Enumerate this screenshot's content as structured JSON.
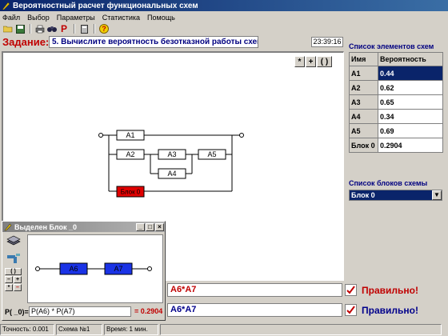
{
  "window": {
    "title": "Вероятностный расчет функциональных схем"
  },
  "menu": [
    "Файл",
    "Выбор",
    "Параметры",
    "Статистика",
    "Помощь"
  ],
  "task": {
    "label": "Задание:",
    "text": "5. Вычислите вероятность безотказной работы схемы",
    "time": "23:39:16"
  },
  "operators": [
    "*",
    "+",
    "( )"
  ],
  "diagram": {
    "blocks": [
      "A1",
      "A2",
      "A3",
      "A4",
      "A5",
      "Блок 0"
    ]
  },
  "elements_list": {
    "title": "Список элементов схем",
    "headers": [
      "Имя",
      "Вероятность"
    ],
    "rows": [
      {
        "name": "A1",
        "value": "0.44"
      },
      {
        "name": "A2",
        "value": "0.62"
      },
      {
        "name": "A3",
        "value": "0.65"
      },
      {
        "name": "A4",
        "value": "0.34"
      },
      {
        "name": "A5",
        "value": "0.69"
      },
      {
        "name": "Блок 0",
        "value": "0.2904"
      }
    ]
  },
  "blocks_list": {
    "title": "Список блоков схемы",
    "selected": "Блок 0"
  },
  "subwindow": {
    "title": "Выделен Блок _0",
    "blocks": [
      "A6",
      "A7"
    ],
    "mini_ops": [
      "( )",
      "–",
      "+",
      "*",
      "–"
    ],
    "formula_label": "P( _0)=",
    "formula": "P(A6) * P(A7)",
    "result": "= 0.2904"
  },
  "answers": [
    {
      "expr": "A6*A7",
      "verdict": "Правильно!"
    },
    {
      "expr": "A6*A7",
      "verdict": "Правильно!"
    }
  ],
  "status": {
    "accuracy": "Точность: 0.001",
    "scheme": "Схема №1",
    "time": "Время: 1 мин."
  }
}
